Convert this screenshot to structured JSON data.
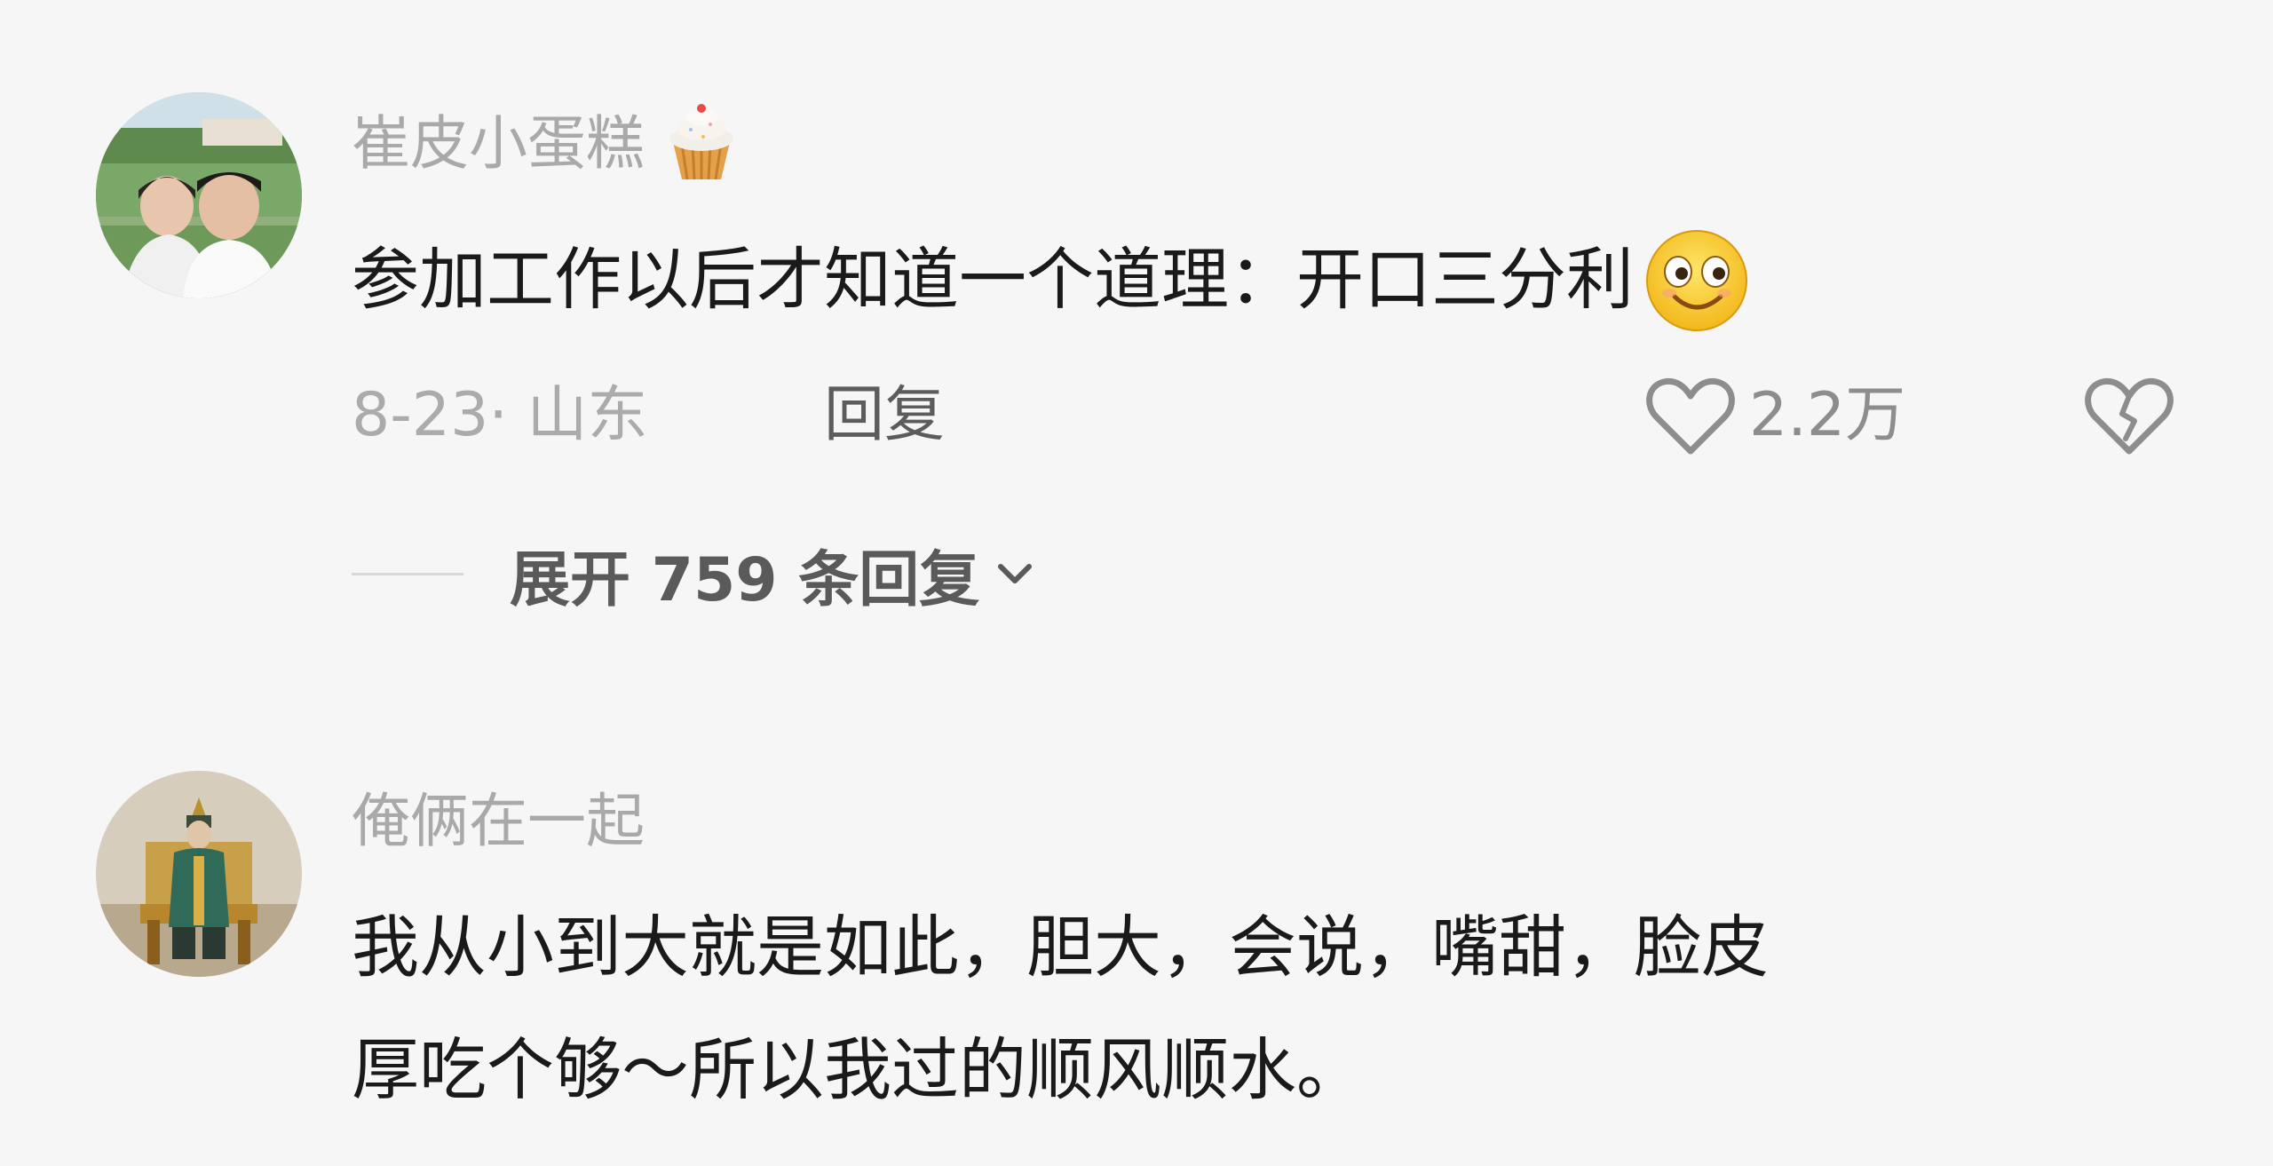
{
  "comments": [
    {
      "username": "崔皮小蛋糕",
      "username_emoji": "cupcake-emoji",
      "content": "参加工作以后才知道一个道理：开口三分利",
      "content_emoji": "smiling-eyes-emoji",
      "date": "8-23· 山东",
      "reply_label": "回复",
      "likes": "2.2万",
      "expand_label": "展开 759 条回复"
    },
    {
      "username": "俺俩在一起",
      "content_line1": "我从小到大就是如此，胆大，会说，嘴甜，脸皮",
      "content_line2": "厚吃个够～所以我过的顺风顺水。"
    }
  ],
  "colors": {
    "background": "#f6f6f6",
    "username": "#a9a9a9",
    "content": "#1a1a1a",
    "meta": "#ababab",
    "icon": "#8d8d8d"
  },
  "icons": [
    "heart-outline-icon",
    "broken-heart-icon",
    "chevron-down-icon"
  ]
}
